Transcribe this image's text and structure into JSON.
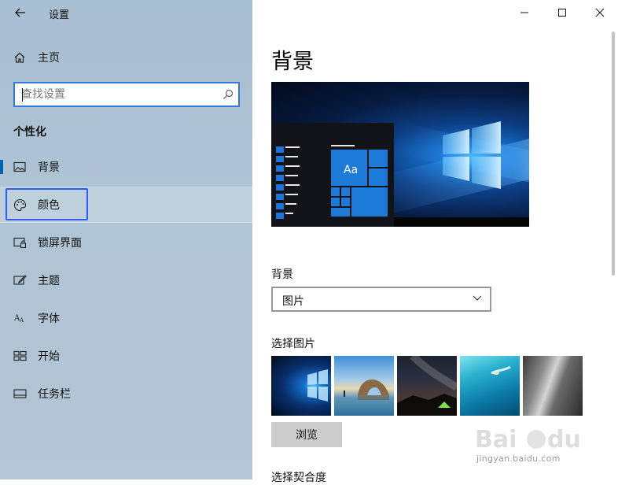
{
  "app": {
    "title": "设置"
  },
  "sidebar": {
    "home_label": "主页",
    "search": {
      "placeholder": "查找设置",
      "value": ""
    },
    "section_heading": "个性化",
    "items": [
      {
        "label": "背景",
        "icon": "image-icon",
        "active": true
      },
      {
        "label": "颜色",
        "icon": "palette-icon",
        "highlighted": true
      },
      {
        "label": "锁屏界面",
        "icon": "lock-screen-icon"
      },
      {
        "label": "主题",
        "icon": "theme-brush-icon"
      },
      {
        "label": "字体",
        "icon": "font-icon"
      },
      {
        "label": "开始",
        "icon": "start-icon"
      },
      {
        "label": "任务栏",
        "icon": "taskbar-icon"
      }
    ]
  },
  "main": {
    "page_title": "背景",
    "preview": {
      "tile_text": "Aa"
    },
    "background_label": "背景",
    "background_select": {
      "selected": "图片"
    },
    "choose_picture_label": "选择图片",
    "thumbnails": [
      "windows-hero",
      "beach-rock-arch",
      "night-sky-tent",
      "underwater-swimmer",
      "rock-cliff"
    ],
    "browse_label": "浏览",
    "fit_label": "选择契合度"
  },
  "watermark": {
    "url": "jingyan.baidu.com"
  },
  "colors": {
    "accent": "#0063b1",
    "highlight_box": "#2e5cff",
    "sidebar_bg": "#aec3d4"
  }
}
